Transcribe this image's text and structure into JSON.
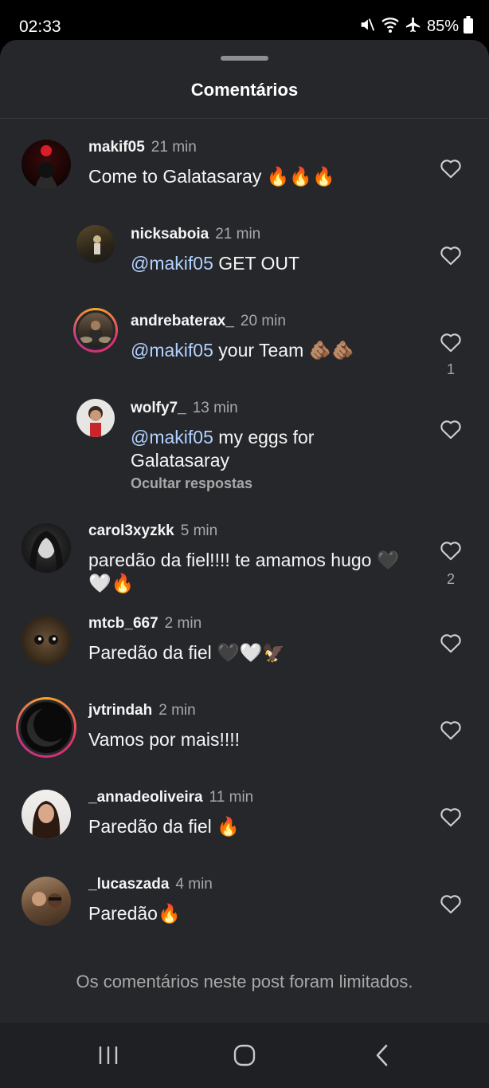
{
  "status_bar": {
    "time": "02:33",
    "battery": "85%",
    "icons": [
      "mute-icon",
      "wifi-icon",
      "airplane-icon",
      "battery-icon"
    ]
  },
  "sheet": {
    "title": "Comentários"
  },
  "comments": [
    {
      "username": "makif05",
      "time": "21 min",
      "mention": "",
      "text": "Come to Galatasaray 🔥🔥🔥",
      "likes": ""
    },
    {
      "username": "nicksaboia",
      "time": "21 min",
      "mention": "@makif05",
      "text": " GET OUT",
      "likes": ""
    },
    {
      "username": "andrebaterax_",
      "time": "20 min",
      "mention": "@makif05",
      "text": " your Team 🫵🏽🫵🏽",
      "likes": "1"
    },
    {
      "username": "wolfy7_",
      "time": "13 min",
      "mention": "@makif05",
      "text": " my eggs for Galatasaray",
      "likes": ""
    },
    {
      "username": "carol3xyzkk",
      "time": "5 min",
      "mention": "",
      "text": "paredão da fiel!!!! te amamos hugo 🖤🤍🔥",
      "likes": "2"
    },
    {
      "username": "mtcb_667",
      "time": "2 min",
      "mention": "",
      "text": "Paredão da fiel 🖤🤍🦅",
      "likes": ""
    },
    {
      "username": "jvtrindah",
      "time": "2 min",
      "mention": "",
      "text": "Vamos por mais!!!!",
      "likes": ""
    },
    {
      "username": "_annadeoliveira",
      "time": "11 min",
      "mention": "",
      "text": "Paredão da fiel 🔥",
      "likes": ""
    },
    {
      "username": "_lucaszada",
      "time": "4 min",
      "mention": "",
      "text": "Paredão🔥",
      "likes": ""
    }
  ],
  "hide_replies_label": "Ocultar respostas",
  "limited_note": "Os comentários neste post foram limitados.",
  "colors": {
    "sheet_bg": "#25272b",
    "mention": "#b3d1ff",
    "secondary_text": "#a8a8a8"
  }
}
